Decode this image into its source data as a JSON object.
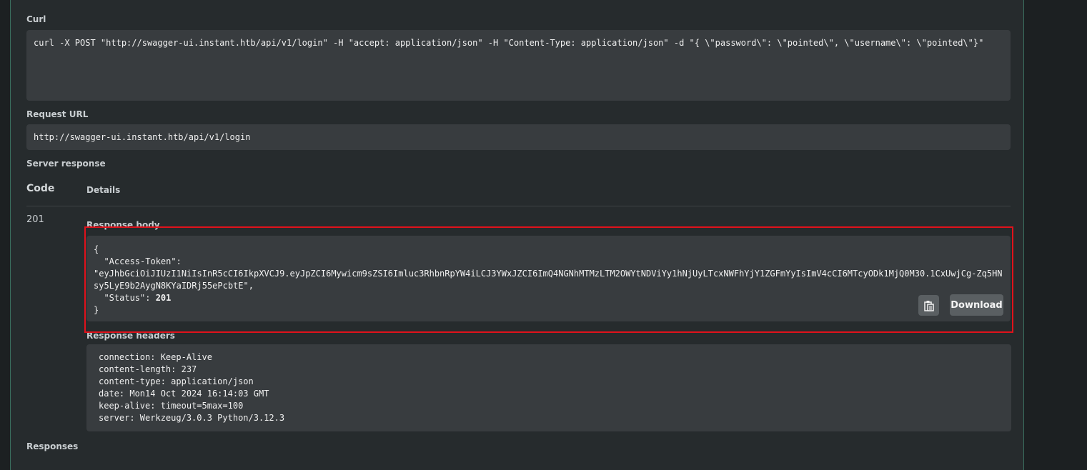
{
  "curl": {
    "label": "Curl",
    "command": "curl -X POST \"http://swagger-ui.instant.htb/api/v1/login\" -H \"accept: application/json\" -H \"Content-Type: application/json\" -d \"{ \\\"password\\\": \\\"pointed\\\", \\\"username\\\": \\\"pointed\\\"}\""
  },
  "request_url": {
    "label": "Request URL",
    "value": "http://swagger-ui.instant.htb/api/v1/login"
  },
  "server_response": {
    "label": "Server response",
    "col_code": "Code",
    "col_details": "Details",
    "code": "201",
    "body_label": "Response body",
    "body": {
      "open": "{",
      "token_key": "  \"Access-Token\":",
      "token_value": "\"eyJhbGciOiJIUzI1NiIsInR5cCI6IkpXVCJ9.eyJpZCI6Mywicm9sZSI6Imluc3RhbnRpYW4iLCJ3YWxJZCI6ImQ4NGNhMTMzLTM2OWYtNDViYy1hNjUyLTcxNWFhYjY1ZGFmYyIsImV4cCI6MTcyODk1MjQ0M30.1CxUwjCg-Zq5HNsy5LyE9b2AygN8KYaIDRj55ePcbtE\",",
      "status_key": "  \"Status\": ",
      "status_value": "201",
      "close": "}"
    },
    "copy_icon": "clipboard-icon",
    "download_label": "Download",
    "headers_label": "Response headers",
    "headers": [
      "connection: Keep-Alive",
      "content-length: 237",
      "content-type: application/json",
      "date: Mon14 Oct 2024 16:14:03 GMT",
      "keep-alive: timeout=5max=100",
      "server: Werkzeug/3.0.3 Python/3.12.3"
    ]
  },
  "responses": {
    "label": "Responses"
  },
  "colors": {
    "highlight_border": "#e0121b",
    "panel_border": "#3a6f5e"
  }
}
